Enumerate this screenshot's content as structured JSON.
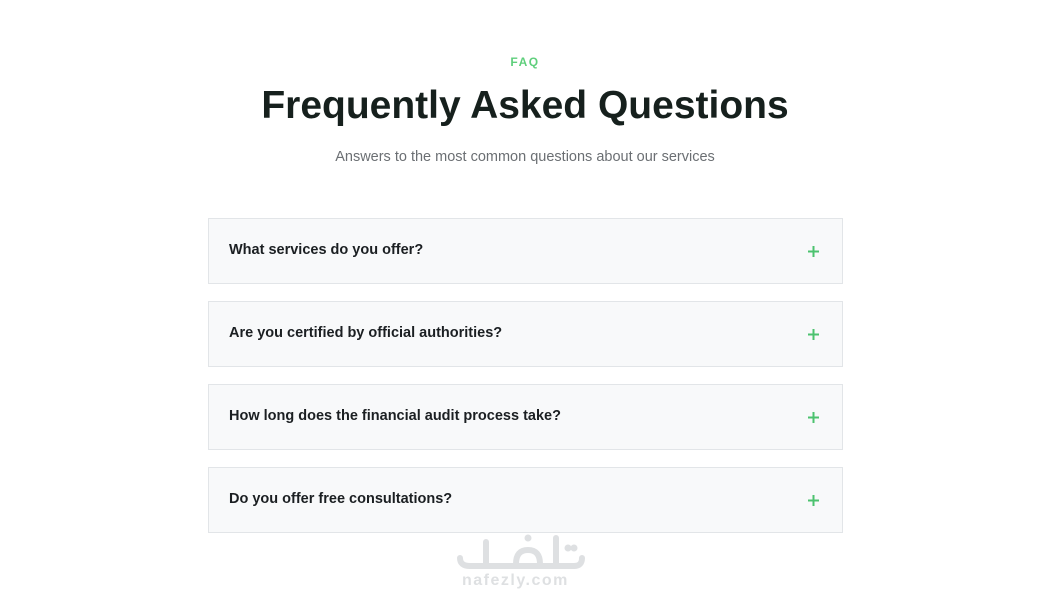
{
  "header": {
    "eyebrow": "FAQ",
    "title": "Frequently Asked Questions",
    "subtitle": "Answers to the most common questions about our services"
  },
  "faq": {
    "items": [
      {
        "question": "What services do you offer?",
        "toggle": "+"
      },
      {
        "question": "Are you certified by official authorities?",
        "toggle": "+"
      },
      {
        "question": "How long does the financial audit process take?",
        "toggle": "+"
      },
      {
        "question": "Do you offer free consultations?",
        "toggle": "+"
      }
    ]
  },
  "watermark": {
    "latin": "nafezly.com"
  },
  "colors": {
    "accent": "#5fcf7c",
    "title": "#16201d",
    "subtitle": "#6b6f73",
    "card_bg": "#f8f9fa",
    "card_border": "#e2e5e8"
  }
}
